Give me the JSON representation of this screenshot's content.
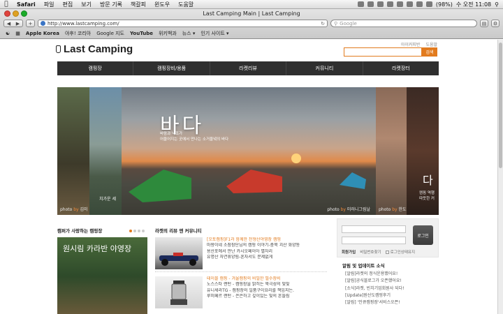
{
  "menubar": {
    "app": "Safari",
    "items": [
      "파일",
      "편집",
      "보기",
      "방문 기록",
      "책갈피",
      "윈도우",
      "도움말"
    ],
    "battery": "(98%)",
    "clock": "수 오전 11:08"
  },
  "window": {
    "title": "Last Camping Main | Last Camping",
    "url": "http://www.lastcamping.com/",
    "search_placeholder": "Google",
    "bookmarks": [
      "Apple Korea",
      "야후! 코리아",
      "Google 지도",
      "YouTube",
      "위키백과",
      "뉴스 ▾",
      "인기 사이트 ▾"
    ]
  },
  "site": {
    "logo": "Last Camping",
    "top_links": [
      "아이커피반",
      "도움말"
    ],
    "search_button": "검색",
    "nav": [
      "캠핑장",
      "캠핑장비/용품",
      "라켓리뷰",
      "커뮤니티",
      "라켓장터"
    ]
  },
  "banner": {
    "hero_title": "바다",
    "hero_desc_1": "바람과 낙조가",
    "hero_desc_2": "어울어지는 곳에서 만나는 소거울녘의 바다",
    "left2_caption": "치가운 세",
    "left1_credit": "김미",
    "hero_credit": "미러니그림날",
    "right1_credit": "한도",
    "side_title": "다",
    "side_desc_1": "캠핑 역행",
    "side_desc_2": "따뜻한 커"
  },
  "col1": {
    "title": "캠퍼가 사랑하는 캠핑장",
    "image_text": "원시림 카라반 야영장"
  },
  "col2": {
    "title": "라켓의 리뷰 앤 커뮤니티",
    "block1": [
      "[오토캠핑]F1과 함께한 천형산야영장 캠핑",
      "마왕이네 소잠잠단님의 캠핑 이야기-충북 괴산 화양동",
      "용산포에서 만난 카시오페이아 별자리",
      "유명산 자연휴양림-혼자서도 문제없게"
    ],
    "block2": [
      "테이블 캠핑 - 겨울캠핑의 비밀한 필수장비",
      "노스스타 랜턴 - 캠핑장을 밝히는 북극성의 빛빛",
      "유니세라TG - 캠핑장의 일품구이요리를 책임지는.",
      "루미페르 랜턴 - 은은하고 깊이있는 빛의 흔들림"
    ]
  },
  "login": {
    "button": "로그인",
    "join": "회원가입",
    "find_pw": "비밀번호찾기",
    "keep": "로그인상태유지"
  },
  "news": {
    "title": "알림 및 업데이트 소식",
    "items": [
      "[알림]라켓의 정식운용했어요!",
      "[알림]공식블로그가 오픈했어요!",
      "[소식]라켓, 빈치기업회원사 되다!",
      "[Update]원산도캠핑후기",
      "[알림] '인큐캠핑장'서비스오픈!"
    ]
  },
  "colors": {
    "accent": "#e27b1e",
    "nav_bg": "#2f2f2f"
  }
}
